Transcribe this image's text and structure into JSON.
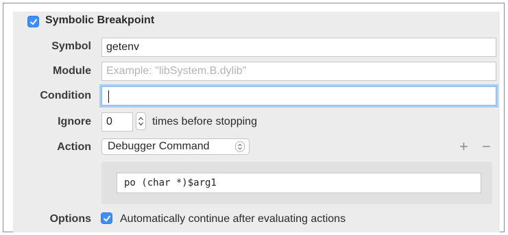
{
  "breakpoint": {
    "enabled": true,
    "title": "Symbolic Breakpoint"
  },
  "symbol": {
    "label": "Symbol",
    "value": "getenv"
  },
  "module": {
    "label": "Module",
    "value": "",
    "placeholder": "Example: \"libSystem.B.dylib\""
  },
  "condition": {
    "label": "Condition",
    "value": ""
  },
  "ignore": {
    "label": "Ignore",
    "value": "0",
    "suffix": "times before stopping"
  },
  "action": {
    "label": "Action",
    "selected": "Debugger Command",
    "add_label": "+",
    "remove_label": "−",
    "command": "po (char *)$arg1"
  },
  "options": {
    "label": "Options",
    "auto_continue_checked": true,
    "auto_continue_label": "Automatically continue after evaluating actions"
  },
  "colors": {
    "accent": "#3d8ef5",
    "focus_ring": "#a9cdf4",
    "pane_bg": "#ececec"
  }
}
